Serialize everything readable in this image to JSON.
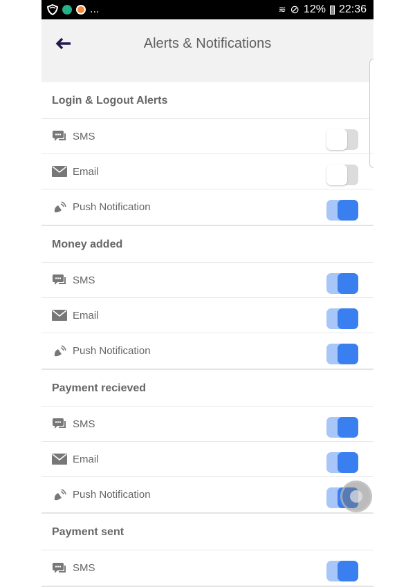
{
  "status_bar": {
    "battery": "12%",
    "time": "22:36",
    "more": "..."
  },
  "header": {
    "title": "Alerts & Notifications",
    "back_icon": "arrow-left-icon"
  },
  "colors": {
    "toggle_on": "#3a7ff0",
    "toggle_on_track": "#a8c6f7",
    "toggle_off_track": "#dcdcdc"
  },
  "sections": [
    {
      "title": "Login & Logout Alerts",
      "items": [
        {
          "label": "SMS",
          "icon": "sms-icon",
          "enabled": false
        },
        {
          "label": "Email",
          "icon": "email-icon",
          "enabled": false
        },
        {
          "label": "Push Notification",
          "icon": "bell-ring-icon",
          "enabled": true
        }
      ]
    },
    {
      "title": "Money added",
      "items": [
        {
          "label": "SMS",
          "icon": "sms-icon",
          "enabled": true
        },
        {
          "label": "Email",
          "icon": "email-icon",
          "enabled": true
        },
        {
          "label": "Push Notification",
          "icon": "bell-ring-icon",
          "enabled": true
        }
      ]
    },
    {
      "title": "Payment recieved",
      "items": [
        {
          "label": "SMS",
          "icon": "sms-icon",
          "enabled": true
        },
        {
          "label": "Email",
          "icon": "email-icon",
          "enabled": true
        },
        {
          "label": "Push Notification",
          "icon": "bell-ring-icon",
          "enabled": true
        }
      ]
    },
    {
      "title": "Payment sent",
      "items": [
        {
          "label": "SMS",
          "icon": "sms-icon",
          "enabled": true
        }
      ]
    }
  ]
}
